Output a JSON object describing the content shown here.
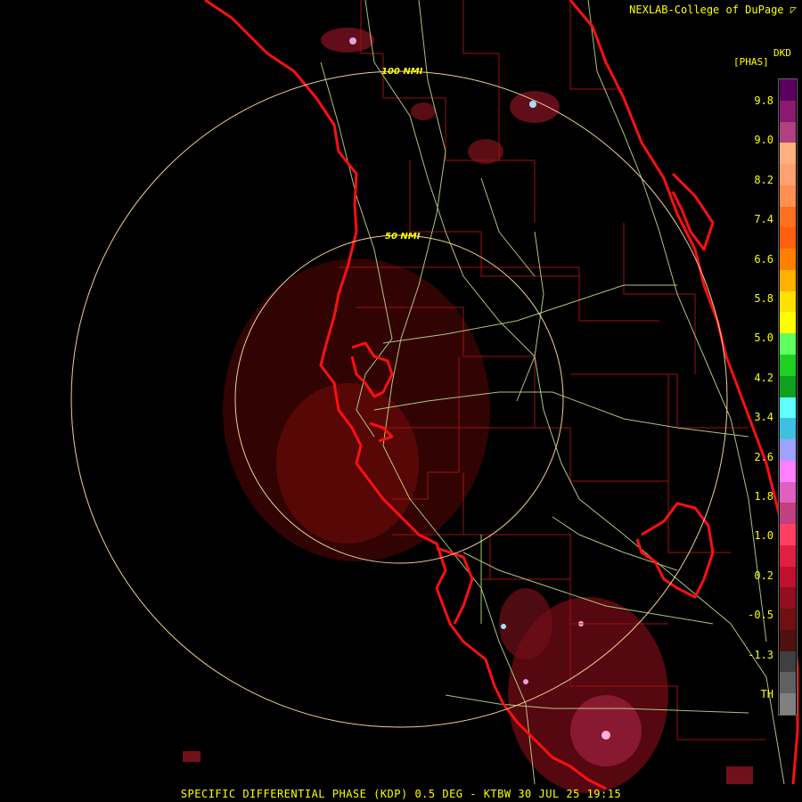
{
  "header": {
    "credit": "NEXLAB-College of DuPage",
    "credit_icon": "radar-logo-icon"
  },
  "legend": {
    "product_code": "DKD",
    "unit": "[PHAS]",
    "ticks": [
      "9.8",
      "9.0",
      "8.2",
      "7.4",
      "6.6",
      "5.8",
      "5.0",
      "4.2",
      "3.4",
      "2.6",
      "1.8",
      "1.0",
      "0.2",
      "-0.5",
      "-1.3",
      "TH"
    ],
    "colors": [
      "#5a0060",
      "#8a1a6e",
      "#b04080",
      "#ffb080",
      "#ffa070",
      "#ff9050",
      "#ff7020",
      "#ff6010",
      "#ff8000",
      "#ffb000",
      "#ffe000",
      "#ffff00",
      "#60ff60",
      "#20d020",
      "#10a020",
      "#60ffff",
      "#40c0e0",
      "#a0a0ff",
      "#ff80ff",
      "#e060c0",
      "#c04080",
      "#ff4060",
      "#e02040",
      "#c01030",
      "#901020",
      "#701010",
      "#501010",
      "#404040",
      "#606060",
      "#808080"
    ]
  },
  "map": {
    "range_rings": [
      {
        "label": "100 NMI"
      },
      {
        "label": "50 NMI"
      }
    ],
    "coastline_color": "#ff1010",
    "county_line_color": "#a01010",
    "road_color": "#c8e890",
    "ring_color": "#f0d090"
  },
  "caption": "SPECIFIC DIFFERENTIAL PHASE (KDP) 0.5 DEG - KTBW 30 JUL 25 19:15"
}
